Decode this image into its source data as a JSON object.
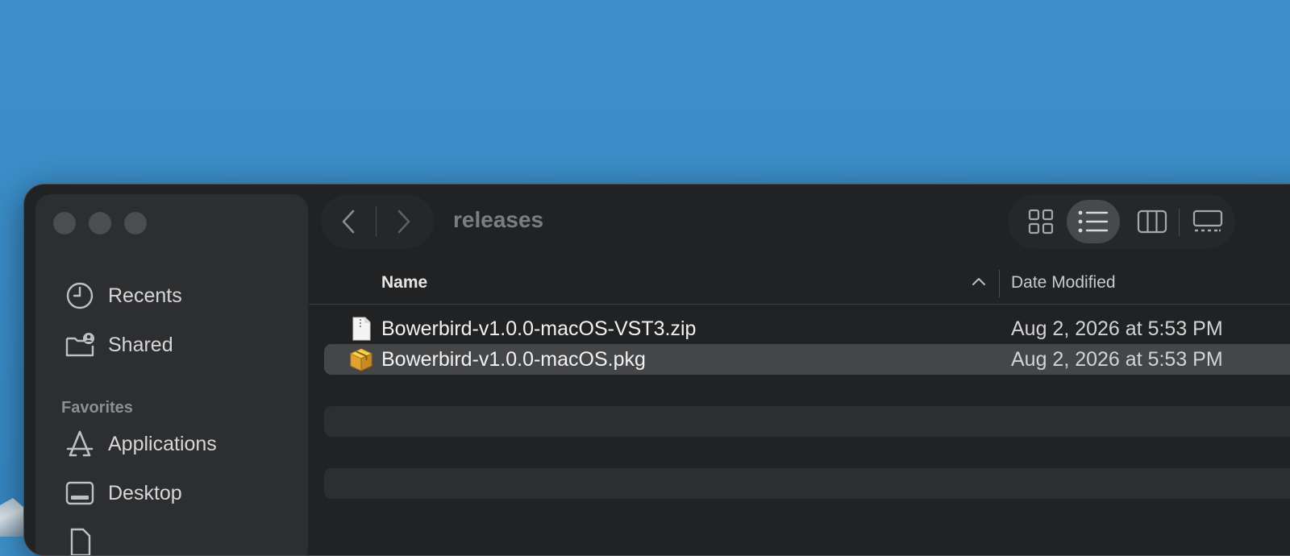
{
  "window": {
    "title": "releases"
  },
  "sidebar": {
    "items_top": [
      {
        "label": "Recents",
        "icon": "clock-icon"
      },
      {
        "label": "Shared",
        "icon": "shared-folder-icon"
      }
    ],
    "favorites_header": "Favorites",
    "favorites": [
      {
        "label": "Applications",
        "icon": "applications-icon"
      },
      {
        "label": "Desktop",
        "icon": "desktop-icon"
      }
    ]
  },
  "list": {
    "columns": {
      "name": "Name",
      "date_modified": "Date Modified"
    },
    "sort": {
      "column": "name",
      "direction": "ascending"
    },
    "rows": [
      {
        "name": "Bowerbird-v1.0.0-macOS-VST3.zip",
        "date": "Aug 2, 2026 at 5:53 PM",
        "icon": "zip-file-icon",
        "selected": false
      },
      {
        "name": "Bowerbird-v1.0.0-macOS.pkg",
        "date": "Aug 2, 2026 at 5:53 PM",
        "icon": "package-icon",
        "selected": true
      }
    ]
  },
  "toolbar": {
    "active_view": "list"
  },
  "colors": {
    "window_bg": "#212223",
    "sidebar_bg": "#2c2e30",
    "selection": "#444648",
    "desktop": "#3a8bc6"
  }
}
